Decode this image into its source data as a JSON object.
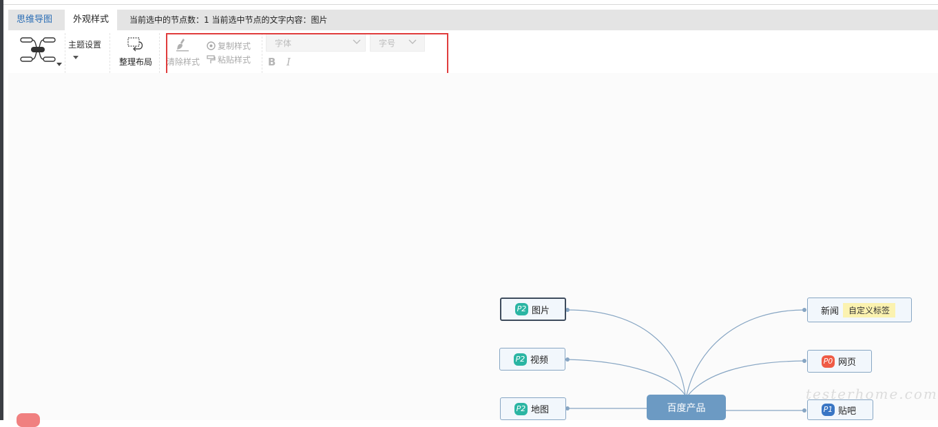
{
  "tabs": [
    {
      "label": "思维导图",
      "active": false
    },
    {
      "label": "外观样式",
      "active": true
    }
  ],
  "status": {
    "text": "当前选中的节点数：1 当前选中节点的文字内容：图片"
  },
  "toolbar": {
    "theme_setting_label": "主题设置",
    "arrange_label": "整理布局",
    "clear_style_label": "清除样式",
    "copy_style_label": "复制样式",
    "paste_style_label": "粘贴样式",
    "font_placeholder": "字体",
    "size_placeholder": "字号",
    "bold_label": "B",
    "italic_label": "I"
  },
  "mindmap": {
    "root": {
      "text": "百度产品"
    },
    "left_nodes": [
      {
        "text": "图片",
        "priority": "P2",
        "selected": true
      },
      {
        "text": "视频",
        "priority": "P2",
        "selected": false
      },
      {
        "text": "地图",
        "priority": "P2",
        "selected": false
      }
    ],
    "right_nodes": [
      {
        "text": "新闻",
        "tag": "自定义标签"
      },
      {
        "text": "网页",
        "priority": "P0"
      },
      {
        "text": "贴吧",
        "priority": "P1"
      }
    ]
  },
  "colors": {
    "p0": "#ef5b45",
    "p1": "#3a76c4",
    "p2": "#2bb5a3",
    "highlight_border": "#e03b3b",
    "root_bg": "#6c9ac3",
    "link": "#86a5c3"
  },
  "watermark": "testerhome.com"
}
